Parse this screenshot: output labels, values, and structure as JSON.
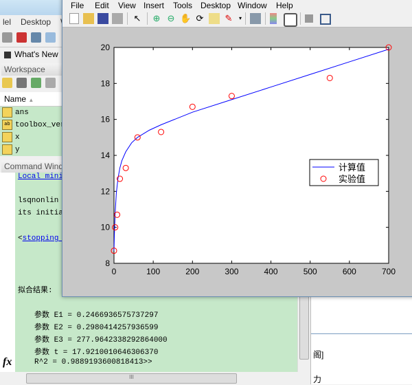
{
  "main_window": {
    "menu": [
      "lel",
      "Desktop",
      "W"
    ],
    "whats_new": "What's New"
  },
  "workspace": {
    "title": "Workspace",
    "column_name": "Name",
    "sort_glyph": "▲",
    "variables": [
      {
        "name": "ans",
        "icon": "grid"
      },
      {
        "name": "toolbox_versi",
        "icon": "ab"
      },
      {
        "name": "x",
        "icon": "grid"
      },
      {
        "name": "y",
        "icon": "grid"
      }
    ]
  },
  "command_window": {
    "title": "Command Windo",
    "lines": {
      "link1": "Local mini",
      "l2": "lsqnonlin",
      "l3": "its initia",
      "link2_prefix": "<",
      "link2": "stopping ",
      "result_header": "拟合结果:",
      "e1": "参数 E1 = 0.2466936575737297",
      "e2": "参数 E2 = 0.2980414257936599",
      "e3": "参数 E3 = 277.9642338292864000",
      "t": "参数 t = 17.9210010646306370",
      "r2": "R^2 = 0.9889193600818413>>"
    },
    "fx_label": "fx",
    "hscroll_grip": "III"
  },
  "right_pane": {
    "t1": "阁]",
    "t2": "力"
  },
  "figure": {
    "menu": [
      "File",
      "Edit",
      "View",
      "Insert",
      "Tools",
      "Desktop",
      "Window",
      "Help"
    ]
  },
  "chart_data": {
    "type": "line",
    "title": "",
    "xlabel": "",
    "ylabel": "",
    "xlim": [
      0,
      700
    ],
    "ylim": [
      8,
      20
    ],
    "xticks": [
      0,
      100,
      200,
      300,
      400,
      500,
      600,
      700
    ],
    "yticks": [
      8,
      10,
      12,
      14,
      16,
      18,
      20
    ],
    "legend_position": "right",
    "series": [
      {
        "name": "计算值",
        "style": "line",
        "color": "#0000ff",
        "x": [
          0,
          1,
          3,
          6,
          10,
          15,
          20,
          30,
          45,
          60,
          90,
          120,
          200,
          300,
          400,
          500,
          600,
          700
        ],
        "y": [
          8.7,
          9.6,
          10.8,
          11.9,
          12.7,
          13.3,
          13.7,
          14.2,
          14.7,
          15.0,
          15.4,
          15.7,
          16.4,
          17.1,
          17.8,
          18.5,
          19.2,
          19.9
        ]
      },
      {
        "name": "实验值",
        "style": "marker-circle",
        "color": "#ff0000",
        "x": [
          0,
          3,
          8,
          15,
          30,
          60,
          120,
          200,
          300,
          550,
          700
        ],
        "y": [
          8.7,
          10.0,
          10.7,
          12.7,
          13.3,
          15.0,
          15.3,
          16.7,
          17.3,
          18.3,
          20.0
        ]
      }
    ]
  }
}
